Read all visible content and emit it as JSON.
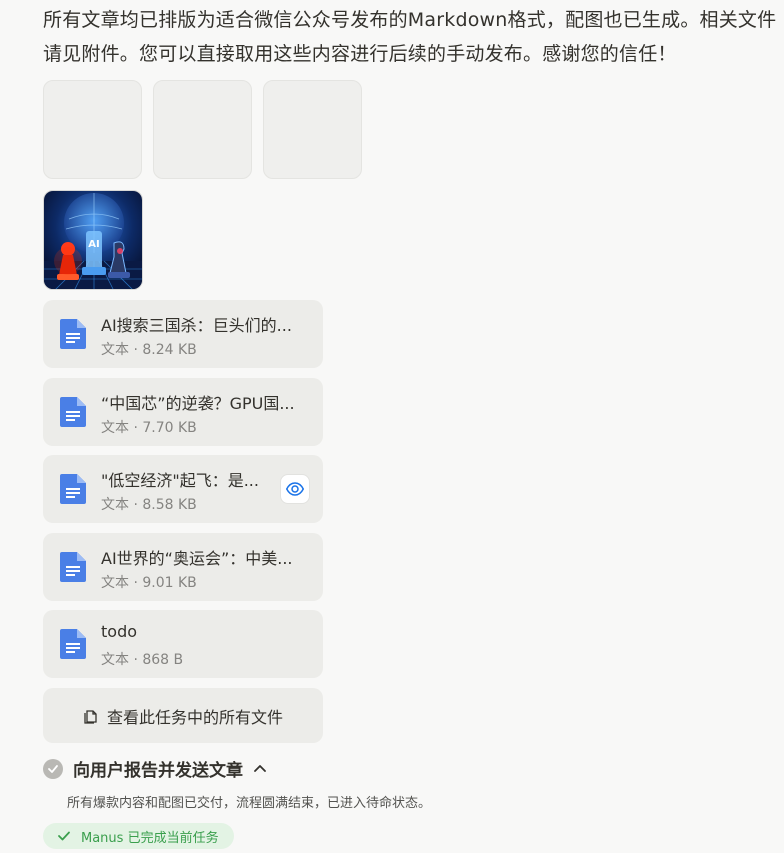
{
  "message": "所有文章均已排版为适合微信公众号发布的Markdown格式，配图也已生成。相关文件请见附件。您可以直接取用这些内容进行后续的手动发布。感谢您的信任！",
  "image_attachment": {
    "caption_text": "AI"
  },
  "files": [
    {
      "name": "AI搜索三国杀：巨头们的...",
      "meta": "文本 · 8.24 KB"
    },
    {
      "name": "“中国芯”的逆袭？GPU国...",
      "meta": "文本 · 7.70 KB"
    },
    {
      "name": "\"低空经济\"起飞：是...",
      "meta": "文本 · 8.58 KB"
    },
    {
      "name": "AI世界的“奥运会”：中美...",
      "meta": "文本 · 9.01 KB"
    },
    {
      "name": "todo",
      "meta": "文本 · 868 B"
    }
  ],
  "view_all_label": "查看此任务中的所有文件",
  "step": {
    "title": "向用户报告并发送文章",
    "description": "所有爆款内容和配图已交付，流程圆满结束，已进入待命状态。"
  },
  "status_badge": "Manus 已完成当前任务",
  "colors": {
    "file_icon": "#4a7fe6",
    "eye_icon": "#1a73e8",
    "success": "#3a9f4d"
  }
}
